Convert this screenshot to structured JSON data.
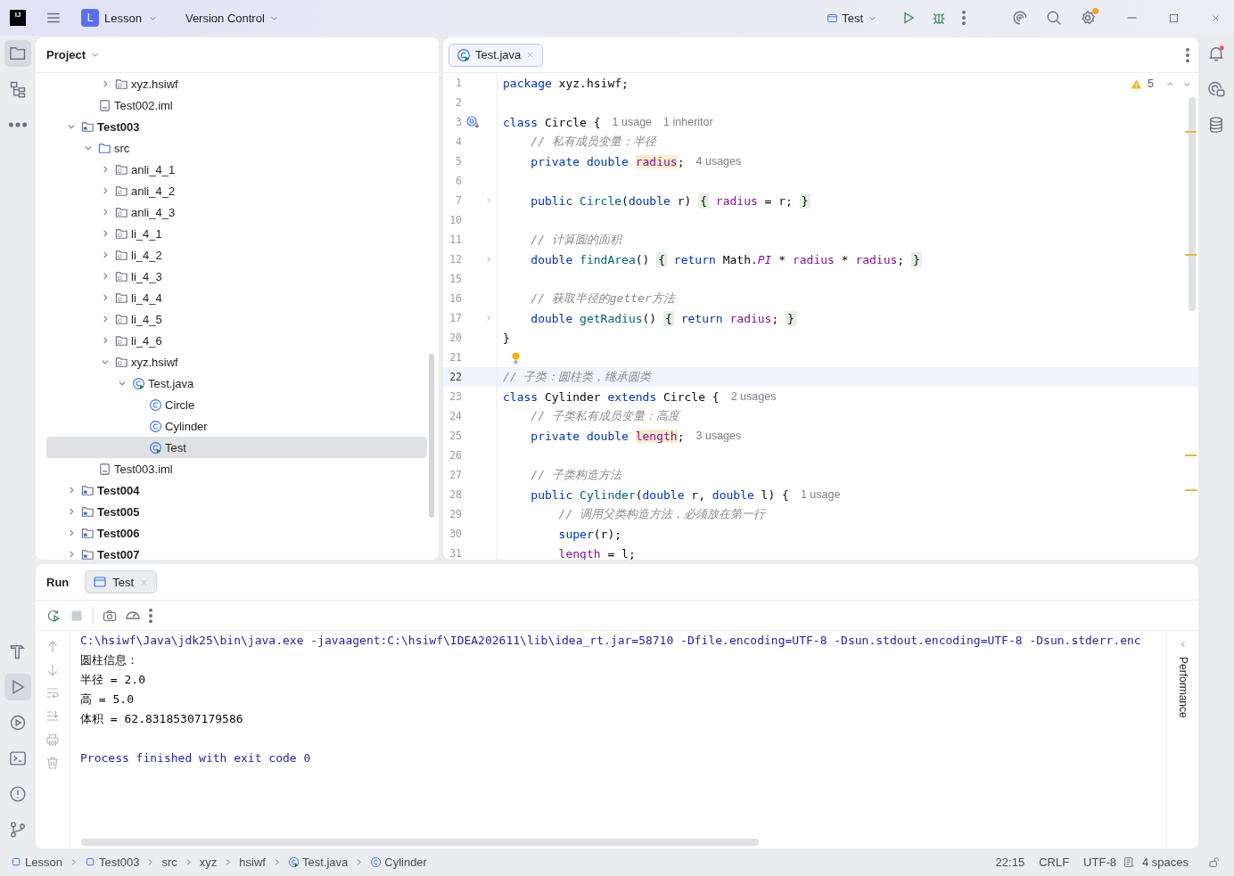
{
  "title_bar": {
    "logo": "IJ",
    "project": {
      "badge": "L",
      "name": "Lesson"
    },
    "vcs": "Version Control",
    "run_config": "Test"
  },
  "left_tools": [
    {
      "kind": "project",
      "selected": true
    },
    {
      "kind": "structure",
      "selected": false
    },
    {
      "kind": "more",
      "selected": false
    }
  ],
  "left_tools_bottom": [
    {
      "kind": "build",
      "selected": false
    },
    {
      "kind": "run",
      "selected": true
    },
    {
      "kind": "services",
      "selected": false
    },
    {
      "kind": "terminal",
      "selected": false
    },
    {
      "kind": "problems",
      "selected": false
    },
    {
      "kind": "git",
      "selected": false
    }
  ],
  "right_tools": [
    {
      "kind": "notifications"
    },
    {
      "kind": "chat"
    },
    {
      "kind": "database"
    }
  ],
  "project": {
    "title": "Project",
    "tree": [
      {
        "children": [
          {
            "children": [
              {
                "label": "xyz.hsiwf",
                "kind": "package",
                "expanded": false,
                "selected": false
              }
            ]
          },
          {
            "label": "Test002.iml",
            "kind": "file",
            "selected": false
          }
        ]
      },
      {
        "label": "Test003",
        "kind": "module",
        "expanded": true,
        "selected": false,
        "children": [
          {
            "label": "src",
            "kind": "source",
            "expanded": true,
            "selected": false,
            "children": [
              {
                "label": "anli_4_1",
                "kind": "package",
                "expanded": false,
                "selected": false
              },
              {
                "label": "anli_4_2",
                "kind": "package",
                "expanded": false,
                "selected": false
              },
              {
                "label": "anli_4_3",
                "kind": "package",
                "expanded": false,
                "selected": false
              },
              {
                "label": "li_4_1",
                "kind": "package",
                "expanded": false,
                "selected": false
              },
              {
                "label": "li_4_2",
                "kind": "package",
                "expanded": false,
                "selected": false
              },
              {
                "label": "li_4_3",
                "kind": "package",
                "expanded": false,
                "selected": false
              },
              {
                "label": "li_4_4",
                "kind": "package",
                "expanded": false,
                "selected": false
              },
              {
                "label": "li_4_5",
                "kind": "package",
                "expanded": false,
                "selected": false
              },
              {
                "label": "li_4_6",
                "kind": "package",
                "expanded": false,
                "selected": false
              },
              {
                "label": "xyz.hsiwf",
                "kind": "package",
                "expanded": true,
                "selected": false,
                "children": [
                  {
                    "label": "Test.java",
                    "kind": "javafile",
                    "expanded": true,
                    "selected": false,
                    "children": [
                      {
                        "label": "Circle",
                        "kind": "class",
                        "selected": false
                      },
                      {
                        "label": "Cylinder",
                        "kind": "class",
                        "selected": false
                      },
                      {
                        "label": "Test",
                        "kind": "javafile",
                        "selected": true
                      }
                    ]
                  }
                ]
              }
            ]
          },
          {
            "label": "Test003.iml",
            "kind": "file",
            "selected": false
          }
        ]
      },
      {
        "label": "Test004",
        "kind": "module",
        "expanded": false,
        "selected": false
      },
      {
        "label": "Test005",
        "kind": "module",
        "expanded": false,
        "selected": false
      },
      {
        "label": "Test006",
        "kind": "module",
        "expanded": false,
        "selected": false
      },
      {
        "label": "Test007",
        "kind": "module",
        "expanded": false,
        "selected": false
      }
    ]
  },
  "editor": {
    "tabs": [
      {
        "label": "Test.java",
        "kind": "javafile",
        "selected": true
      }
    ],
    "warnings": "5",
    "lines": [
      {
        "number": "1",
        "kind": "plain",
        "current": false,
        "tokens": [
          {
            "kind": "kw",
            "text": "package"
          },
          {
            "kind": "t",
            "text": " xyz.hsiwf;"
          }
        ]
      },
      {
        "number": "2",
        "kind": "plain",
        "current": false
      },
      {
        "number": "3",
        "kind": "override",
        "current": false,
        "tokens": [
          {
            "kind": "kw",
            "text": "class"
          },
          {
            "kind": "t",
            "text": " Circle {"
          },
          {
            "kind": "hint",
            "text": "1 usage"
          },
          {
            "kind": "hint",
            "text": "1 inheritor"
          }
        ]
      },
      {
        "number": "4",
        "kind": "plain",
        "current": false,
        "tokens": [
          {
            "kind": "com",
            "text": "    // 私有成员变量：半径"
          }
        ]
      },
      {
        "number": "5",
        "kind": "plain",
        "current": false,
        "tokens": [
          {
            "kind": "kw",
            "text": "    private double "
          },
          {
            "kind": "hlf",
            "text": "radius"
          },
          {
            "kind": "t",
            "text": ";"
          },
          {
            "kind": "hint",
            "text": "4 usages"
          }
        ]
      },
      {
        "number": "6",
        "kind": "plain",
        "current": false
      },
      {
        "number": "7",
        "kind": "fold",
        "current": false,
        "tokens": [
          {
            "kind": "kw",
            "text": "    public "
          },
          {
            "kind": "decl",
            "text": "Circle"
          },
          {
            "kind": "t",
            "text": "("
          },
          {
            "kind": "kw",
            "text": "double"
          },
          {
            "kind": "t",
            "text": " r) "
          },
          {
            "kind": "fold",
            "text": "{"
          },
          {
            "kind": "fld",
            "text": " radius"
          },
          {
            "kind": "t",
            "text": " = r; "
          },
          {
            "kind": "fold",
            "text": "}"
          }
        ]
      },
      {
        "number": "10",
        "kind": "plain",
        "current": false
      },
      {
        "number": "11",
        "kind": "plain",
        "current": false,
        "tokens": [
          {
            "kind": "com",
            "text": "    // 计算圆的面积"
          }
        ]
      },
      {
        "number": "12",
        "kind": "fold",
        "current": false,
        "tokens": [
          {
            "kind": "kw",
            "text": "    double "
          },
          {
            "kind": "decl",
            "text": "findArea"
          },
          {
            "kind": "t",
            "text": "() "
          },
          {
            "kind": "fold",
            "text": "{"
          },
          {
            "kind": "kw",
            "text": " return"
          },
          {
            "kind": "t",
            "text": " Math."
          },
          {
            "kind": "st",
            "text": "PI"
          },
          {
            "kind": "t",
            "text": " * "
          },
          {
            "kind": "fld",
            "text": "radius"
          },
          {
            "kind": "t",
            "text": " * "
          },
          {
            "kind": "fld",
            "text": "radius"
          },
          {
            "kind": "t",
            "text": "; "
          },
          {
            "kind": "fold",
            "text": "}"
          }
        ]
      },
      {
        "number": "15",
        "kind": "plain",
        "current": false
      },
      {
        "number": "16",
        "kind": "plain",
        "current": false,
        "tokens": [
          {
            "kind": "com",
            "text": "    // 获取半径的getter方法"
          }
        ]
      },
      {
        "number": "17",
        "kind": "fold",
        "current": false,
        "tokens": [
          {
            "kind": "kw",
            "text": "    double "
          },
          {
            "kind": "decl",
            "text": "getRadius"
          },
          {
            "kind": "t",
            "text": "() "
          },
          {
            "kind": "fold",
            "text": "{"
          },
          {
            "kind": "kw",
            "text": " return "
          },
          {
            "kind": "fld",
            "text": "radius"
          },
          {
            "kind": "t",
            "text": "; "
          },
          {
            "kind": "fold",
            "text": "}"
          }
        ]
      },
      {
        "number": "20",
        "kind": "plain",
        "current": false,
        "tokens": [
          {
            "kind": "t",
            "text": "}"
          }
        ]
      },
      {
        "number": "21",
        "kind": "bulb",
        "current": false
      },
      {
        "number": "22",
        "kind": "plain",
        "current": true,
        "tokens": [
          {
            "kind": "com",
            "text": "// 子类：圆柱类，继承圆类"
          }
        ]
      },
      {
        "number": "23",
        "kind": "plain",
        "current": false,
        "tokens": [
          {
            "kind": "kw",
            "text": "class"
          },
          {
            "kind": "t",
            "text": " Cylinder "
          },
          {
            "kind": "kw",
            "text": "extends"
          },
          {
            "kind": "t",
            "text": " Circle {"
          },
          {
            "kind": "hint",
            "text": "2 usages"
          }
        ]
      },
      {
        "number": "24",
        "kind": "plain",
        "current": false,
        "tokens": [
          {
            "kind": "com",
            "text": "    // 子类私有成员变量：高度"
          }
        ]
      },
      {
        "number": "25",
        "kind": "plain",
        "current": false,
        "tokens": [
          {
            "kind": "kw",
            "text": "    private double "
          },
          {
            "kind": "hlf",
            "text": "length"
          },
          {
            "kind": "t",
            "text": ";"
          },
          {
            "kind": "hint",
            "text": "3 usages"
          }
        ]
      },
      {
        "number": "26",
        "kind": "plain",
        "current": false
      },
      {
        "number": "27",
        "kind": "plain",
        "current": false,
        "tokens": [
          {
            "kind": "com",
            "text": "    // 子类构造方法"
          }
        ]
      },
      {
        "number": "28",
        "kind": "plain",
        "current": false,
        "tokens": [
          {
            "kind": "kw",
            "text": "    public "
          },
          {
            "kind": "decl",
            "text": "Cylinder"
          },
          {
            "kind": "t",
            "text": "("
          },
          {
            "kind": "kw",
            "text": "double"
          },
          {
            "kind": "t",
            "text": " r, "
          },
          {
            "kind": "kw",
            "text": "double"
          },
          {
            "kind": "t",
            "text": " l) {"
          },
          {
            "kind": "hint",
            "text": "1 usage"
          }
        ]
      },
      {
        "number": "29",
        "kind": "plain",
        "current": false,
        "tokens": [
          {
            "kind": "com",
            "text": "        // 调用父类构造方法，必须放在第一行"
          }
        ]
      },
      {
        "number": "30",
        "kind": "plain",
        "current": false,
        "tokens": [
          {
            "kind": "kw",
            "text": "        super"
          },
          {
            "kind": "t",
            "text": "(r);"
          }
        ]
      },
      {
        "number": "31",
        "kind": "plain",
        "current": false,
        "tokens": [
          {
            "kind": "fld",
            "text": "        length"
          },
          {
            "kind": "t",
            "text": " = l;"
          }
        ]
      }
    ]
  },
  "run_panel": {
    "title": "Run",
    "tabs": [
      {
        "label": "Test",
        "selected": true
      }
    ],
    "side_label": "Performance",
    "console": [
      {
        "kind": "cmd",
        "text": "C:\\hsiwf\\Java\\jdk25\\bin\\java.exe -javaagent:C:\\hsiwf\\IDEA202611\\lib\\idea_rt.jar=58710 -Dfile.encoding=UTF-8 -Dsun.stdout.encoding=UTF-8 -Dsun.stderr.enc"
      },
      {
        "kind": "out",
        "text": "圆柱信息："
      },
      {
        "kind": "out",
        "text": "半径 = 2.0"
      },
      {
        "kind": "out",
        "text": "高 = 5.0"
      },
      {
        "kind": "out",
        "text": "体积 = 62.83185307179586"
      },
      {
        "kind": "blank"
      },
      {
        "kind": "exit",
        "text": "Process finished with exit code 0"
      }
    ]
  },
  "status_bar": {
    "breadcrumbs": [
      {
        "label": "Lesson",
        "kind": "mod"
      },
      {
        "label": "Test003",
        "kind": "mod"
      },
      {
        "label": "src",
        "kind": "plain"
      },
      {
        "label": "xyz",
        "kind": "plain"
      },
      {
        "label": "hsiwf",
        "kind": "plain"
      },
      {
        "label": "Test.java",
        "kind": "javafile"
      },
      {
        "label": "Cylinder",
        "kind": "class"
      }
    ],
    "position": "22:15",
    "line_separator": "CRLF",
    "encoding": "UTF-8",
    "indent": "4 spaces"
  }
}
